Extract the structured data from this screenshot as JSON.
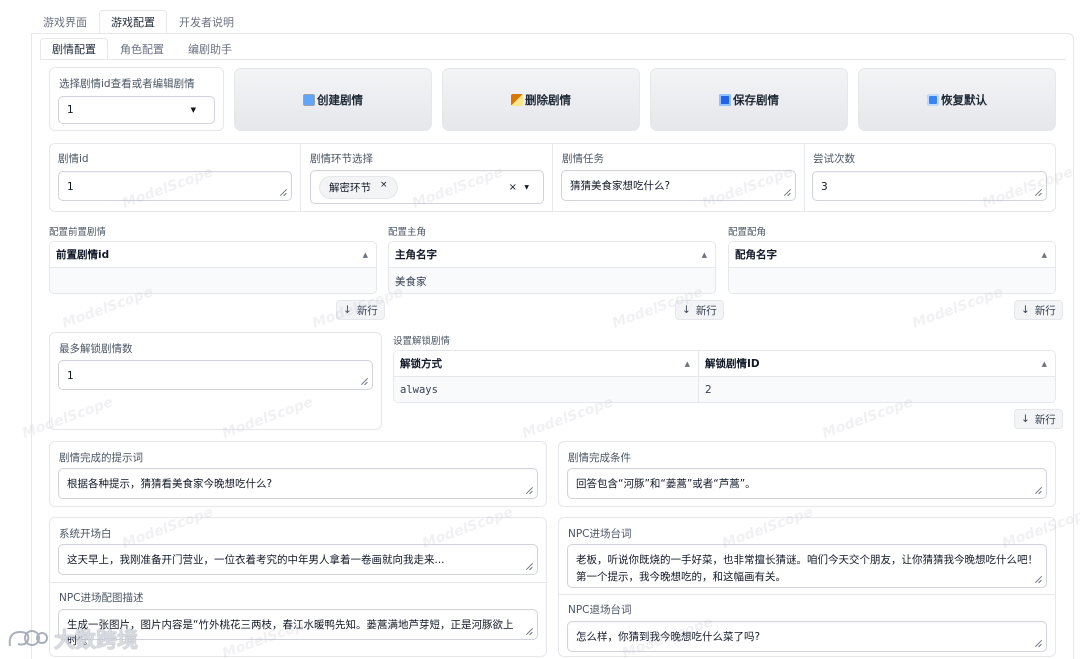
{
  "top_tabs": [
    "游戏界面",
    "游戏配置",
    "开发者说明"
  ],
  "sub_tabs": [
    "剧情配置",
    "角色配置",
    "编剧助手"
  ],
  "select_story": {
    "label": "选择剧情id查看或者编辑剧情",
    "value": "1"
  },
  "buttons": {
    "create": "创建剧情",
    "delete": "删除剧情",
    "save": "保存剧情",
    "reset": "恢复默认"
  },
  "icons": {
    "create": "keyboard-icon",
    "delete": "broom-icon",
    "save": "floppy-icon",
    "reset": "refresh-icon"
  },
  "story_id": {
    "label": "剧情id",
    "value": "1"
  },
  "story_stage": {
    "label": "剧情环节选择",
    "chip": "解密环节",
    "chip_close": "×",
    "clear": "×"
  },
  "story_task": {
    "label": "剧情任务",
    "value": "猜猜美食家想吃什么?"
  },
  "attempts": {
    "label": "尝试次数",
    "value": "3"
  },
  "prev_story": {
    "label": "配置前置剧情",
    "header": "前置剧情id",
    "new_row": "新行"
  },
  "protagonist": {
    "label": "配置主角",
    "header": "主角名字",
    "rows": [
      "美食家"
    ],
    "new_row": "新行"
  },
  "supporting": {
    "label": "配置配角",
    "header": "配角名字",
    "new_row": "新行"
  },
  "max_unlock": {
    "label": "最多解锁剧情数",
    "value": "1"
  },
  "unlock": {
    "label": "设置解锁剧情",
    "headers": [
      "解锁方式",
      "解锁剧情ID"
    ],
    "rows": [
      [
        "always",
        "2"
      ]
    ],
    "new_row": "新行"
  },
  "prompt": {
    "label": "剧情完成的提示词",
    "value": "根据各种提示，猜猜看美食家今晚想吃什么?"
  },
  "condition": {
    "label": "剧情完成条件",
    "value": "回答包含“河豚”和“蒌蒿”或者“芦蒿”。"
  },
  "opening": {
    "label": "系统开场白",
    "value": "这天早上，我刚准备开门营业，一位衣着考究的中年男人拿着一卷画就向我走来..."
  },
  "npc_enter": {
    "label": "NPC进场台词",
    "value": "老板，听说你既烧的一手好菜，也非常擅长猜谜。咱们今天交个朋友，让你猜猜我今晚想吃什么吧！第一个提示，我今晚想吃的，和这幅画有关。"
  },
  "npc_image": {
    "label": "NPC进场配图描述",
    "value": "生成一张图片，图片内容是“竹外桃花三两枝，春江水暖鸭先知。蒌蒿满地芦芽短，正是河豚欲上时”。"
  },
  "npc_exit": {
    "label": "NPC退场台词",
    "value": "怎么样，你猜到我今晚想吃什么菜了吗?"
  },
  "watermark_text": "大数跨境",
  "watermark_repeat": "ModelScope"
}
